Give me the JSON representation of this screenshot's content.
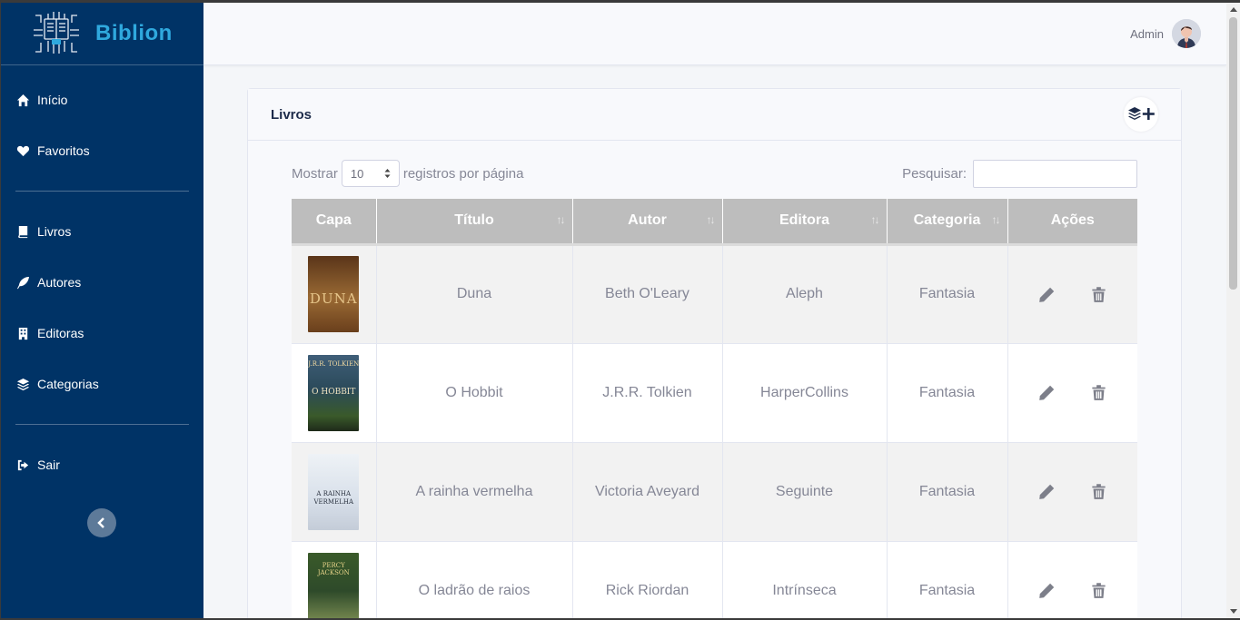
{
  "brand": {
    "name": "Biblion"
  },
  "topbar": {
    "user_name": "Admin"
  },
  "sidebar": {
    "items": [
      {
        "label": "Início",
        "icon": "home-icon"
      },
      {
        "label": "Favoritos",
        "icon": "heart-icon"
      },
      {
        "label": "Livros",
        "icon": "book-icon"
      },
      {
        "label": "Autores",
        "icon": "feather-icon"
      },
      {
        "label": "Editoras",
        "icon": "building-icon"
      },
      {
        "label": "Categorias",
        "icon": "layers-icon"
      },
      {
        "label": "Sair",
        "icon": "sign-out-icon"
      }
    ]
  },
  "card": {
    "title": "Livros",
    "add_icon": "layer-plus-icon"
  },
  "controls": {
    "show_label": "Mostrar",
    "page_length": "10",
    "per_page_label": "registros por página",
    "search_label": "Pesquisar:",
    "search_value": ""
  },
  "table": {
    "headers": [
      "Capa",
      "Título",
      "Autor",
      "Editora",
      "Categoria",
      "Ações"
    ],
    "rows": [
      {
        "title": "Duna",
        "author": "Beth O'Leary",
        "publisher": "Aleph",
        "category": "Fantasia",
        "cover_text": "DUNA",
        "cover_color": "#7a4a1e"
      },
      {
        "title": "O Hobbit",
        "author": "J.R.R. Tolkien",
        "publisher": "HarperCollins",
        "category": "Fantasia",
        "cover_text": "J.R.R. TOLKIEN",
        "cover_color": "#2b4a5a"
      },
      {
        "title": "A rainha vermelha",
        "author": "Victoria Aveyard",
        "publisher": "Seguinte",
        "category": "Fantasia",
        "cover_text": "A RAINHA VERMELHA",
        "cover_color": "#dfe6ee"
      },
      {
        "title": "O ladrão de raios",
        "author": "Rick Riordan",
        "publisher": "Intrínseca",
        "category": "Fantasia",
        "cover_text": "PERCY JACKSON",
        "cover_color": "#2e4a2a"
      }
    ]
  },
  "colors": {
    "sidebar": "#003366",
    "brand": "#2fa9de",
    "header_bg": "#bdbdbd"
  }
}
